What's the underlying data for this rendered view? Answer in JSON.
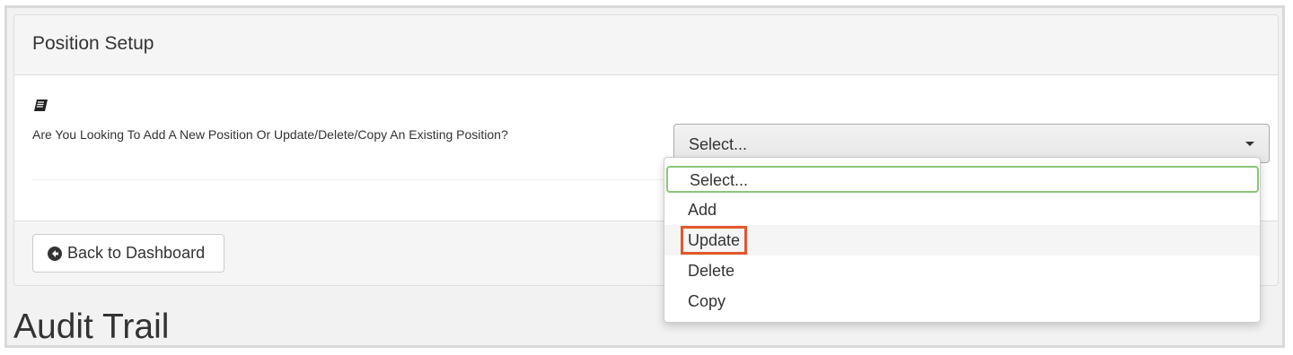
{
  "panel": {
    "title": "Position Setup",
    "icon": "book-icon",
    "question": "Are You Looking To Add A New Position Or Update/Delete/Copy An Existing Position?",
    "select": {
      "value": "Select...",
      "options": [
        "Select...",
        "Add",
        "Update",
        "Delete",
        "Copy"
      ],
      "highlighted_option": "Update"
    },
    "footer": {
      "back_label": "Back to Dashboard",
      "back_icon": "arrow-left-circle-icon"
    }
  },
  "audit": {
    "title": "Audit Trail"
  },
  "colors": {
    "focus_border": "#8bc57a",
    "annotation": "#e2572d"
  }
}
